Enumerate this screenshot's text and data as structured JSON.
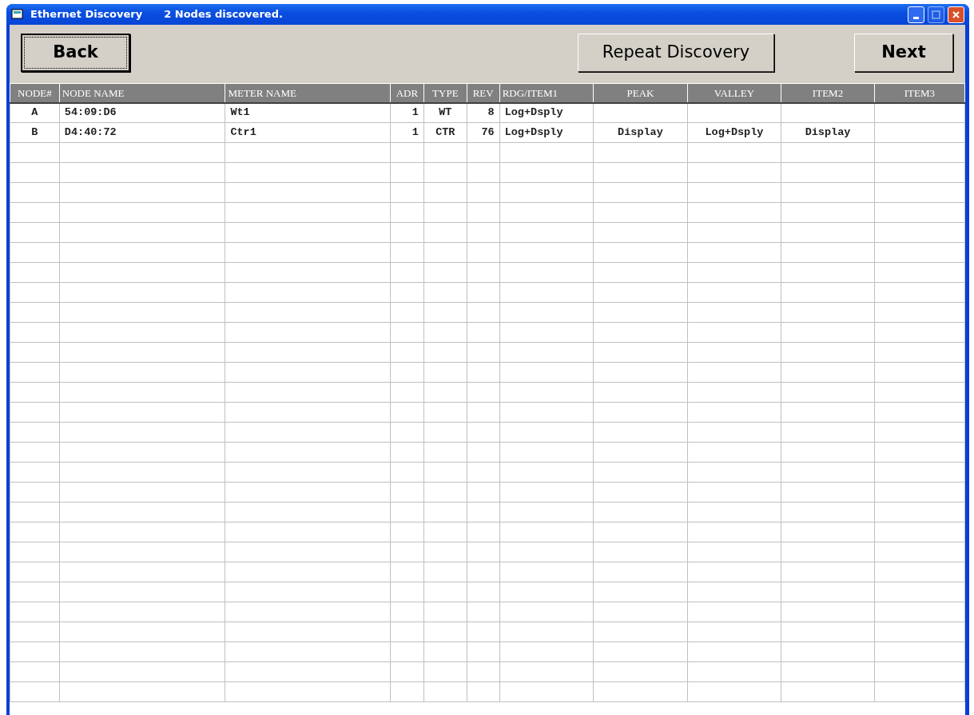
{
  "window": {
    "title": "Ethernet Discovery",
    "status": "2 Nodes discovered.",
    "maximize_disabled": true
  },
  "toolbar": {
    "buttons": [
      {
        "label": "Back",
        "focused": true
      },
      {
        "label": "Repeat Discovery",
        "focused": false
      },
      {
        "label": "Next",
        "focused": false
      }
    ]
  },
  "table": {
    "columns": [
      "NODE#",
      "NODE NAME",
      "METER NAME",
      "ADR",
      "TYPE",
      "REV",
      "RDG/ITEM1",
      "PEAK",
      "VALLEY",
      "ITEM2",
      "ITEM3"
    ],
    "rows": [
      [
        "A",
        "54:09:D6",
        "Wt1",
        "1",
        "WT",
        "8",
        "Log+Dsply",
        "",
        "",
        "",
        ""
      ],
      [
        "B",
        "D4:40:72",
        "Ctr1",
        "1",
        "CTR",
        "76",
        "Log+Dsply",
        "Display",
        "Log+Dsply",
        "Display",
        ""
      ]
    ]
  }
}
